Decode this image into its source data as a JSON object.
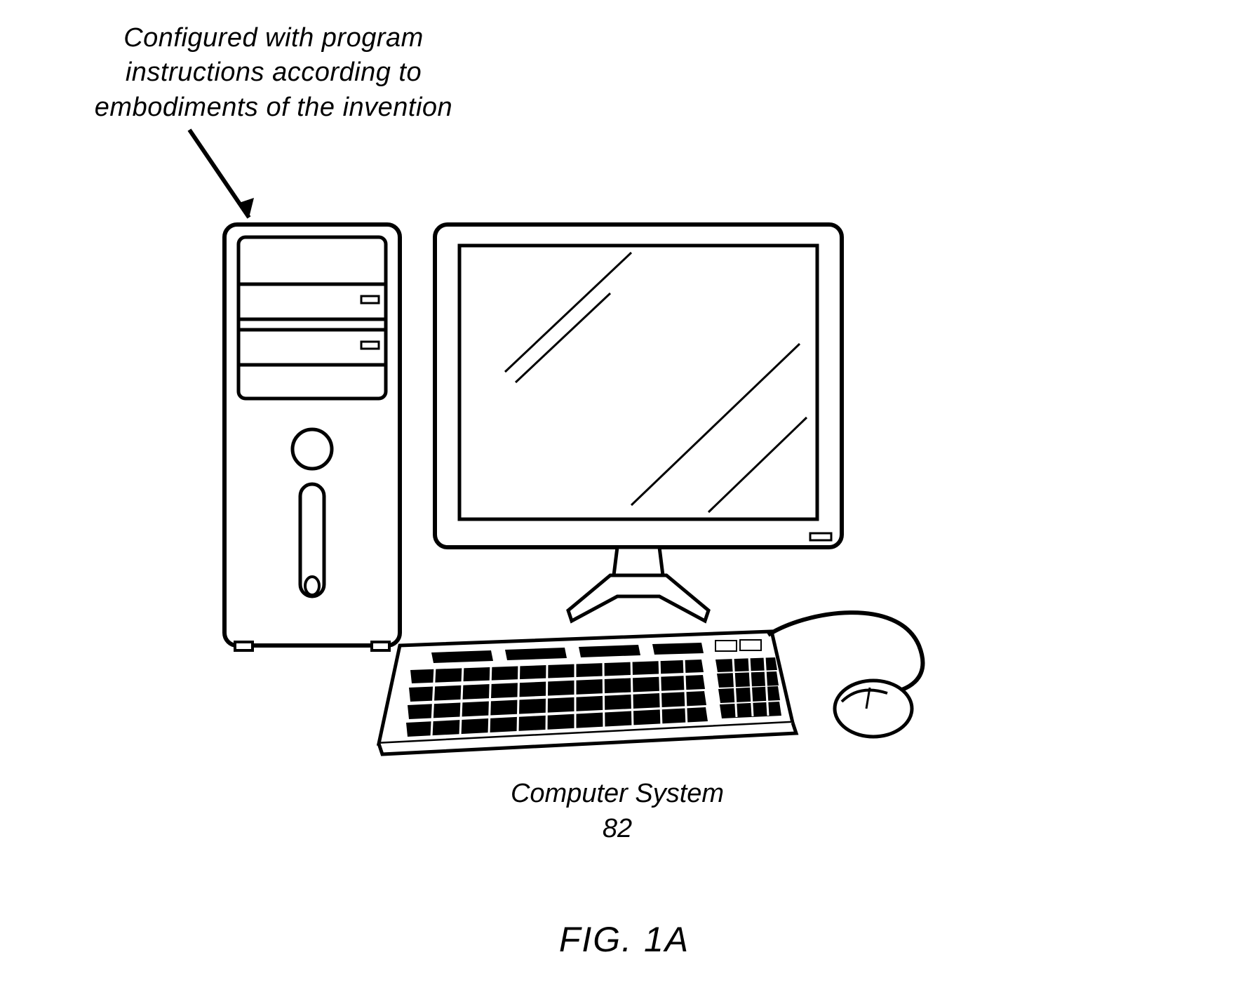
{
  "annotation": {
    "line1": "Configured with program",
    "line2": "instructions according to",
    "line3": "embodiments of the invention"
  },
  "caption": {
    "label": "Computer System",
    "number": "82"
  },
  "figure": "FIG. 1A",
  "components": {
    "tower": "computer-tower",
    "monitor": "monitor",
    "keyboard": "keyboard",
    "mouse": "mouse",
    "arrow": "pointer-arrow"
  }
}
